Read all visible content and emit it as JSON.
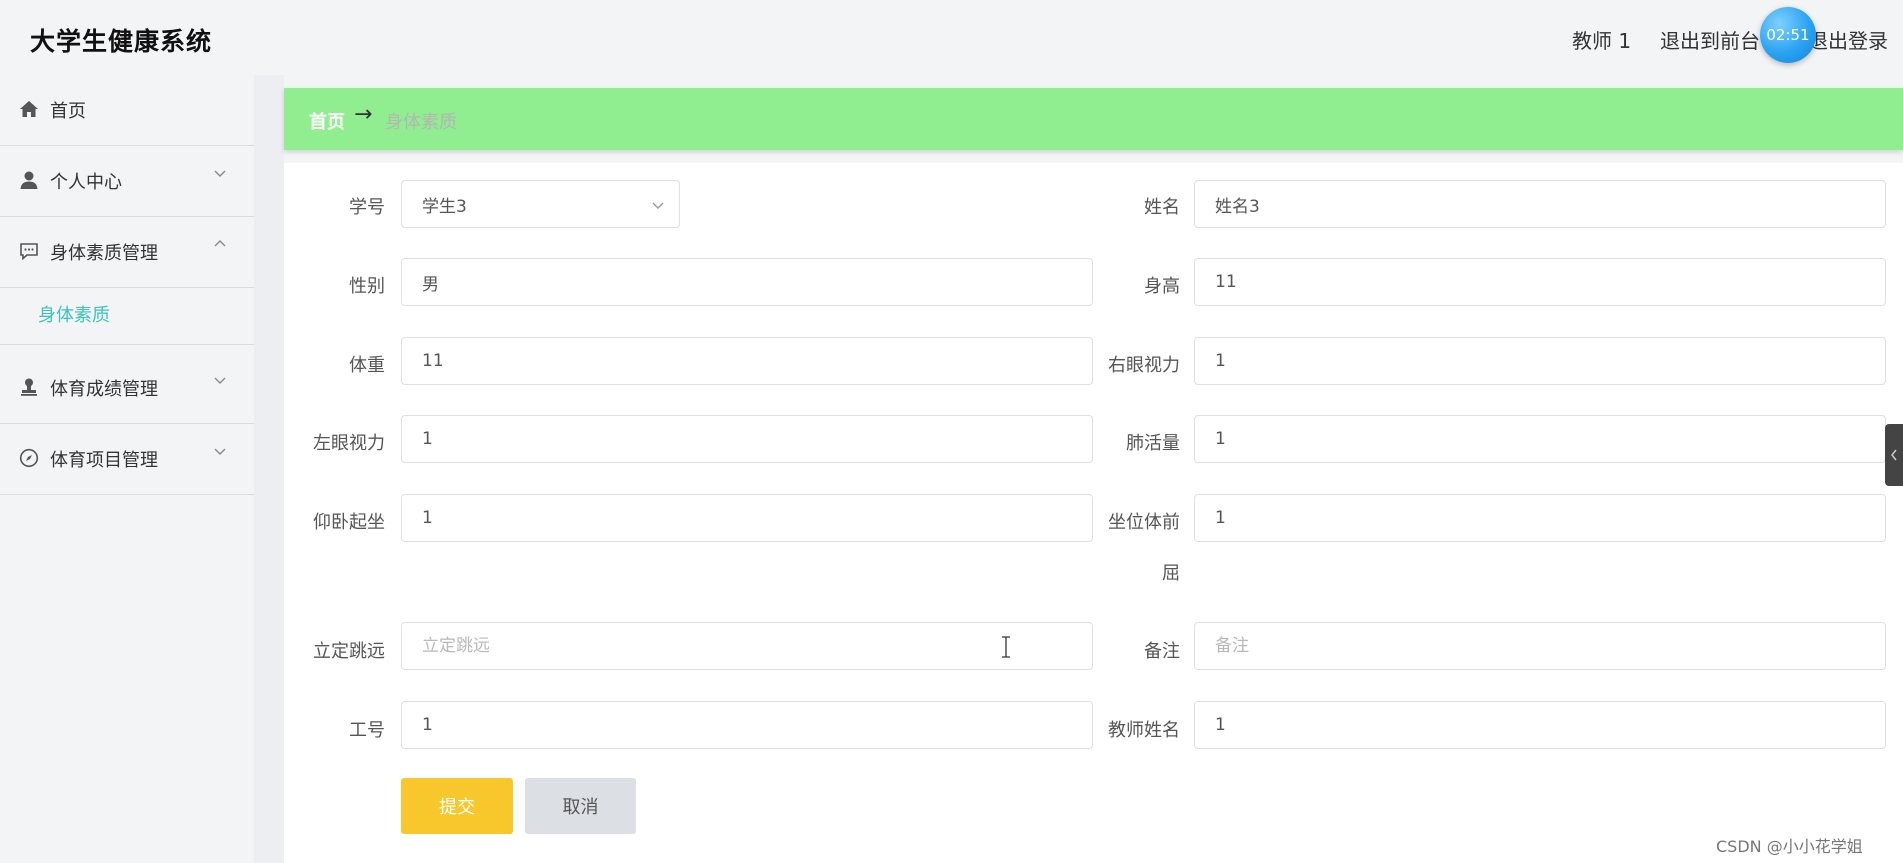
{
  "header": {
    "app_title": "大学生健康系统",
    "user_name": "教师 1",
    "exit_front": "退出到前台",
    "logout": "退出登录",
    "timer": "02:51"
  },
  "sidebar": {
    "items": [
      {
        "label": "首页",
        "icon": "home-icon"
      },
      {
        "label": "个人中心",
        "icon": "user-icon",
        "expanded": false
      },
      {
        "label": "身体素质管理",
        "icon": "chat-icon",
        "expanded": true
      },
      {
        "label": "体育成绩管理",
        "icon": "stamp-icon",
        "expanded": false
      },
      {
        "label": "体育项目管理",
        "icon": "compass-icon",
        "expanded": false
      }
    ],
    "subitem": {
      "label": "身体素质",
      "color": "#3cc3bf"
    }
  },
  "breadcrumb": {
    "home": "首页",
    "arrow": "→",
    "current": "身体素质",
    "bg_color": "#90ee90"
  },
  "form": {
    "student_id": {
      "label": "学号",
      "value": "学生3"
    },
    "name": {
      "label": "姓名",
      "value": "姓名3"
    },
    "gender": {
      "label": "性别",
      "value": "男"
    },
    "height": {
      "label": "身高",
      "value": "11"
    },
    "weight": {
      "label": "体重",
      "value": "11"
    },
    "right_eye": {
      "label": "右眼视力",
      "value": "1"
    },
    "left_eye": {
      "label": "左眼视力",
      "value": "1"
    },
    "lung": {
      "label": "肺活量",
      "value": "1"
    },
    "situp": {
      "label": "仰卧起坐",
      "value": "1"
    },
    "sit_reach": {
      "label_line1": "坐位体前",
      "label_line2": "屈",
      "value": "1"
    },
    "long_jump": {
      "label": "立定跳远",
      "value": "",
      "placeholder": "立定跳远"
    },
    "remark": {
      "label": "备注",
      "value": "",
      "placeholder": "备注"
    },
    "teacher_id": {
      "label": "工号",
      "value": "1"
    },
    "teacher_name": {
      "label": "教师姓名",
      "value": "1"
    },
    "submit_label": "提交",
    "cancel_label": "取消",
    "submit_color": "#f8c72c",
    "cancel_color": "#dcdfe4"
  },
  "watermark": "CSDN @小小花学姐"
}
